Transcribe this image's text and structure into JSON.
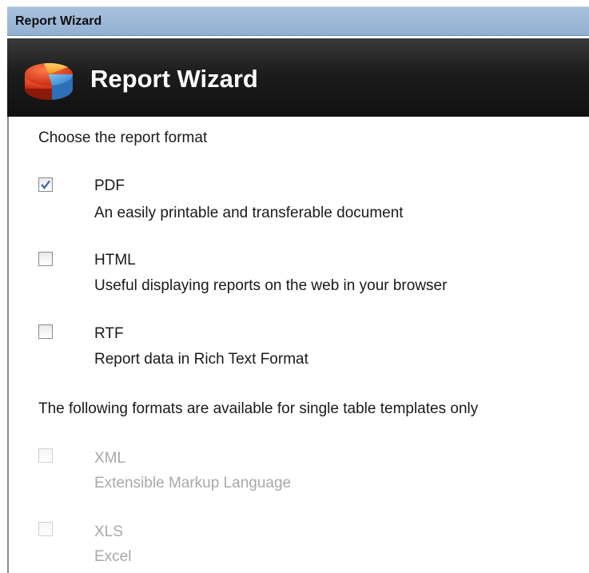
{
  "window": {
    "title": "Report Wizard"
  },
  "banner": {
    "title": "Report Wizard",
    "icon": "report-wizard-logo-icon"
  },
  "section1": {
    "prompt": "Choose the report format",
    "options": [
      {
        "name": "PDF",
        "description": "An easily printable and transferable document",
        "checked": true,
        "enabled": true
      },
      {
        "name": "HTML",
        "description": "Useful displaying reports on the web in your browser",
        "checked": false,
        "enabled": true
      },
      {
        "name": "RTF",
        "description": "Report data in Rich Text Format",
        "checked": false,
        "enabled": true
      }
    ]
  },
  "section2": {
    "prompt": "The following formats are available for single table templates only",
    "options": [
      {
        "name": "XML",
        "description": "Extensible Markup Language",
        "checked": false,
        "enabled": false
      },
      {
        "name": "XLS",
        "description": "Excel",
        "checked": false,
        "enabled": false
      }
    ]
  },
  "colors": {
    "titlebar": "#9db8d8",
    "banner": "#1c1c1c",
    "check": "#3a5fa8",
    "disabled_text": "#a8a8a8"
  }
}
